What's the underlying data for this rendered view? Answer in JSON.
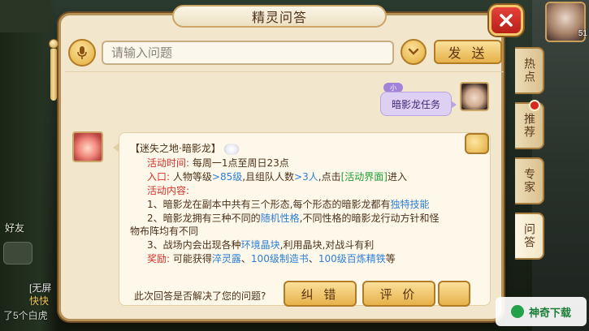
{
  "dialog": {
    "title": "精灵问答",
    "input_placeholder": "请输入问题",
    "send_label": "发 送"
  },
  "side_tabs": [
    {
      "label": "热点",
      "active": false
    },
    {
      "label": "推荐",
      "active": false,
      "badge": "red-dot"
    },
    {
      "label": "专家",
      "active": false
    },
    {
      "label": "问答",
      "active": true
    }
  ],
  "user_message": {
    "name_badge": "小",
    "text": "暗影龙任务"
  },
  "bot_message": {
    "title": "【迷失之地·暗影龙】",
    "time_label": "活动时间:",
    "time_value": "每周一1点至周日23点",
    "entry_label": "入口:",
    "entry_level_text": "人物等级",
    "entry_level_value": ">85级",
    "entry_team_text": ",且组队人数",
    "entry_team_value": ">3人",
    "entry_click_text": ",点击",
    "entry_link": "[活动界面]",
    "entry_end": "进入",
    "content_label": "活动内容:",
    "item1_prefix": "1、暗影龙在副本中共有三个形态,每个形态的暗影龙都有",
    "item1_highlight": "独特技能",
    "item2_prefix": "2、暗影龙拥有三种不同的",
    "item2_highlight": "随机性格",
    "item2_suffix": ",不同性格的暗影龙行动方针和怪",
    "item2_line2": "物布阵均有不同",
    "item3_prefix": "3、战场内会出现各种",
    "item3_highlight": "环境晶块",
    "item3_suffix": ",利用晶块,对战斗有利",
    "reward_label": "奖励:",
    "reward_prefix": "可能获得",
    "reward_item1": "淬灵露",
    "reward_item2": "100级制造书",
    "reward_item3": "100级百炼精铁",
    "reward_end": "等"
  },
  "feedback": {
    "question": "此次回答是否解决了您的问题?",
    "correct_label": "纠 错",
    "rate_label": "评 价"
  },
  "background": {
    "left_text_1": "好友",
    "left_text_2": "[无屏",
    "left_text_3": "快快",
    "left_text_4": "了5个白虎",
    "right_level": "51"
  },
  "watermark": {
    "text": "神奇下载"
  },
  "colors": {
    "panel_bg": "#f2e7cc",
    "panel_border": "#b68f55",
    "label_red": "#d2332b",
    "link_blue": "#2d7fd6",
    "link_green": "#1f9e37",
    "close_red": "#d0302a",
    "button_gold": "#e6b14a",
    "user_bubble": "#ddd0f3"
  }
}
